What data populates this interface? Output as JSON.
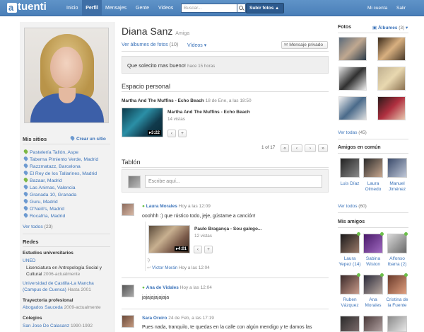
{
  "header": {
    "logo_text": "tuenti",
    "nav": [
      "Inicio",
      "Perfil",
      "Mensajes",
      "Gente",
      "Videos"
    ],
    "search_placeholder": "Buscar...",
    "upload_label": "Subir fotos",
    "account_label": "Mi cuenta",
    "logout_label": "Salir"
  },
  "sidebar": {
    "my_sites_title": "Mis sitios",
    "create_site": "Crear un sitio",
    "sites": [
      "Pastelería Tallón, Aspe",
      "Taberna Pimiento Verde, Madrid",
      "Razzmatazz, Barcelona",
      "El Rey de los Tallarines, Madrid",
      "Bazaar, Madrid",
      "Las Animas, Valencia",
      "Granada 10, Granada",
      "Guru, Madrid",
      "O'Neill's, Madrid",
      "Rocafría, Madrid"
    ],
    "see_all": "Ver todos",
    "see_all_count": "(23)",
    "networks_title": "Redes",
    "uni_title": "Estudios universitarios",
    "uni1": "UNED",
    "uni1_detail": "Licenciatura en Antropología Social y",
    "uni1_detail2": "Cultural",
    "uni1_years": "2006-actualmente",
    "uni2": "Universidad de Castilla-La Mancha",
    "uni2b": "(Campus de Cuenca)",
    "uni2_years": "Hasta 2001",
    "career_title": "Trayectoria profesional",
    "career": "Abogados Sauceda",
    "career_years": "2009-actualmente",
    "schools_title": "Colegios",
    "school": "San Jose De Calasanz",
    "school_years": "1990-1992"
  },
  "profile": {
    "name": "Diana Sanz",
    "relation": "Amiga",
    "albums_link": "Ver álbumes de fotos",
    "albums_count": "(10)",
    "videos_link": "Vídeos",
    "private_msg": "Mensaje privado",
    "status": "Que solecito mas bueno!",
    "status_time": "hace 15 horas"
  },
  "personal_space": {
    "title": "Espacio personal",
    "entry_title": "Martha And The Muffins - Echo Beach",
    "entry_date": "18 de Ene, a las 18:50",
    "video_title": "Martha And The Muffins - Echo Beach",
    "video_views": "14 vistas",
    "video_duration": "3:22",
    "pager": "1 of 17"
  },
  "wall": {
    "title": "Tablón",
    "input_placeholder": "Escribe aquí...",
    "posts": [
      {
        "author": "Laura Morales",
        "time": "Hoy a las 12:09",
        "text": "ooohhh :) que rústico todo, jeje, gústame a canción!",
        "video_title": "Paulo Bragança - Sou galego...",
        "video_views": "12 vistas",
        "video_duration": "4:01",
        "reply_author": "Víctor Morán",
        "reply_time": "Hoy a las 12:04",
        "reply_prefix": ":)"
      },
      {
        "author": "Ana de Vidales",
        "time": "Hoy a las 12:04",
        "text": "jajajajajajaja"
      },
      {
        "author": "Sara Oreiro",
        "time": "24 de Feb, a las 17:19",
        "text": "Pues nada, tranquilo, te quedas en la calle con algún mendigo y te damos las"
      }
    ]
  },
  "photos": {
    "title": "Fotos",
    "albums_label": "Álbumes",
    "albums_count": "(3)",
    "see_all": "Ver todas",
    "see_all_count": "(45)"
  },
  "common_friends": {
    "title": "Amigos en común",
    "friends": [
      [
        "Luis Díaz"
      ],
      [
        "Laura",
        "Olmedo"
      ],
      [
        "Manuel",
        "Jiménez"
      ]
    ],
    "see_all": "Ver todos",
    "see_all_count": "(60)"
  },
  "my_friends": {
    "title": "Mis amigos",
    "friends": [
      [
        "Laura",
        "Yepez (14)"
      ],
      [
        "Sabina",
        "Wiston"
      ],
      [
        "Alfonso",
        "Ibarra (2)"
      ],
      [
        "Ruben",
        "Vázquez"
      ],
      [
        "Ana",
        "Morales"
      ],
      [
        "Cristina de",
        "la Fuente"
      ]
    ]
  }
}
